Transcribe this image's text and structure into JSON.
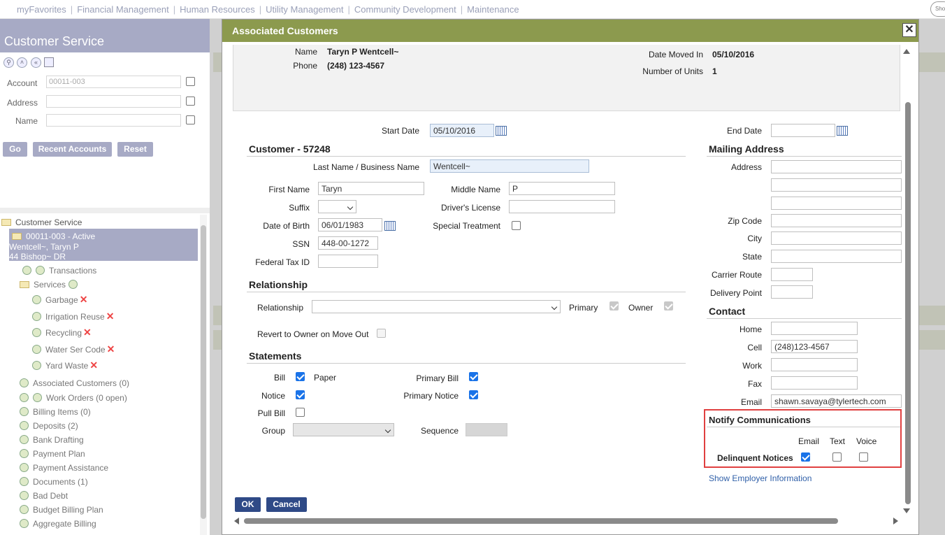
{
  "topnav": {
    "items": [
      "myFavorites",
      "Financial Management",
      "Human Resources",
      "Utility Management",
      "Community Development",
      "Maintenance"
    ],
    "show_button": "Show"
  },
  "leftpanel": {
    "title": "Customer Service",
    "account_label": "Account",
    "account_value": "00011-003",
    "address_label": "Address",
    "name_label": "Name",
    "buttons": {
      "go": "Go",
      "recent": "Recent Accounts",
      "reset": "Reset"
    },
    "tree": {
      "root": "Customer Service",
      "selected_line1": "00011-003 - Active",
      "selected_line2": "Wentcell~, Taryn P",
      "selected_line3": "44 Bishop~ DR",
      "transactions": "Transactions",
      "services": "Services",
      "service_items": [
        "Garbage",
        "Irrigation Reuse",
        "Recycling",
        "Water Ser Code",
        "Yard Waste"
      ],
      "items": [
        "Associated Customers (0)",
        "Work Orders (0 open)",
        "Billing Items (0)",
        "Deposits (2)",
        "Bank Drafting",
        "Payment Plan",
        "Payment Assistance",
        "Documents (1)",
        "Bad Debt",
        "Budget Billing Plan",
        "Aggregate Billing"
      ]
    }
  },
  "modal": {
    "title": "Associated Customers",
    "info": {
      "name_label": "Name",
      "name_value": "Taryn P Wentcell~",
      "phone_label": "Phone",
      "phone_value": "(248) 123-4567",
      "moved_label": "Date Moved In",
      "moved_value": "05/10/2016",
      "units_label": "Number of Units",
      "units_value": "1"
    },
    "start_date_label": "Start Date",
    "start_date_value": "05/10/2016",
    "end_date_label": "End Date",
    "end_date_value": "",
    "customer_header": "Customer - 57248",
    "last_name_label": "Last Name / Business Name",
    "last_name_value": "Wentcell~",
    "first_name_label": "First Name",
    "first_name_value": "Taryn",
    "middle_name_label": "Middle Name",
    "middle_name_value": "P",
    "suffix_label": "Suffix",
    "drivers_license_label": "Driver's License",
    "dob_label": "Date of Birth",
    "dob_value": "06/01/1983",
    "special_treatment_label": "Special Treatment",
    "ssn_label": "SSN",
    "ssn_value": "448-00-1272",
    "fed_tax_label": "Federal Tax ID",
    "relationship_header": "Relationship",
    "relationship_label": "Relationship",
    "primary_label": "Primary",
    "owner_label": "Owner",
    "revert_label": "Revert to Owner on Move Out",
    "statements_header": "Statements",
    "bill_label": "Bill",
    "paper_label": "Paper",
    "primary_bill_label": "Primary Bill",
    "notice_label": "Notice",
    "primary_notice_label": "Primary Notice",
    "pull_bill_label": "Pull Bill",
    "group_label": "Group",
    "sequence_label": "Sequence",
    "mailing_header": "Mailing Address",
    "address_label": "Address",
    "zip_label": "Zip Code",
    "city_label": "City",
    "state_label": "State",
    "carrier_label": "Carrier Route",
    "delivery_label": "Delivery Point",
    "contact_header": "Contact",
    "home_label": "Home",
    "cell_label": "Cell",
    "cell_value": "(248)123-4567",
    "work_label": "Work",
    "fax_label": "Fax",
    "email_label": "Email",
    "email_value": "shawn.savaya@tylertech.com",
    "notify_header": "Notify Communications",
    "notify_cols": [
      "Email",
      "Text",
      "Voice"
    ],
    "notify_row": "Delinquent Notices",
    "employer_link": "Show Employer Information",
    "ok": "OK",
    "cancel": "Cancel"
  }
}
